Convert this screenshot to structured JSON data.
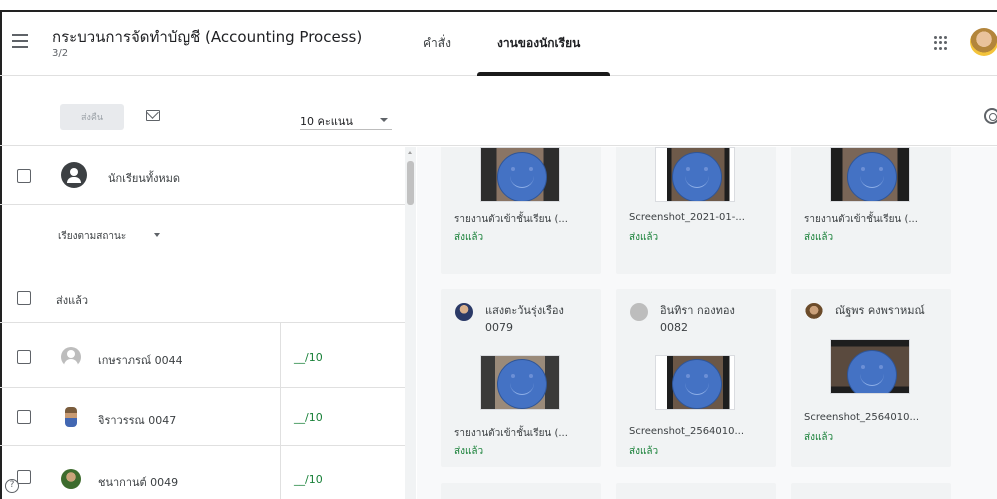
{
  "header": {
    "class_title": "กระบวนการจัดทำบัญชี (Accounting Process)",
    "class_subtitle": "3/2",
    "tabs": [
      {
        "label": "คำสั่ง"
      },
      {
        "label": "งานของนักเรียน"
      }
    ]
  },
  "toolbar": {
    "return_label": "ส่งคืน",
    "points_value": "10 คะแนน"
  },
  "left_panel": {
    "all_students_label": "นักเรียนทั้งหมด",
    "sort_label": "เรียงตามสถานะ",
    "section_label": "ส่งแล้ว",
    "students": [
      {
        "name": "เกษราภรณ์ 0044",
        "grade": "__/10"
      },
      {
        "name": "จิราวรรณ 0047",
        "grade": "__/10"
      },
      {
        "name": "ชนากานต์ 0049",
        "grade": "__/10"
      }
    ]
  },
  "submissions": {
    "top_row": [
      {
        "file": "รายงานตัวเข้าชั้นเรียน (...",
        "status": "ส่งแล้ว"
      },
      {
        "file": "Screenshot_2021-01-...",
        "status": "ส่งแล้ว"
      },
      {
        "file": "รายงานตัวเข้าชั้นเรียน (...",
        "status": "ส่งแล้ว"
      }
    ],
    "mid_row": [
      {
        "name_line1": "แสงตะวันรุ่งเรือง",
        "name_line2": "0079",
        "file": "รายงานตัวเข้าชั้นเรียน (...",
        "status": "ส่งแล้ว"
      },
      {
        "name_line1": "อินทิรา กองทอง",
        "name_line2": "0082",
        "file": "Screenshot_2564010...",
        "status": "ส่งแล้ว"
      },
      {
        "name_line1": "ณัฐพร คงพราหมณ์",
        "name_line2": "",
        "file": "Screenshot_2564010...",
        "status": "ส่งแล้ว"
      }
    ]
  }
}
